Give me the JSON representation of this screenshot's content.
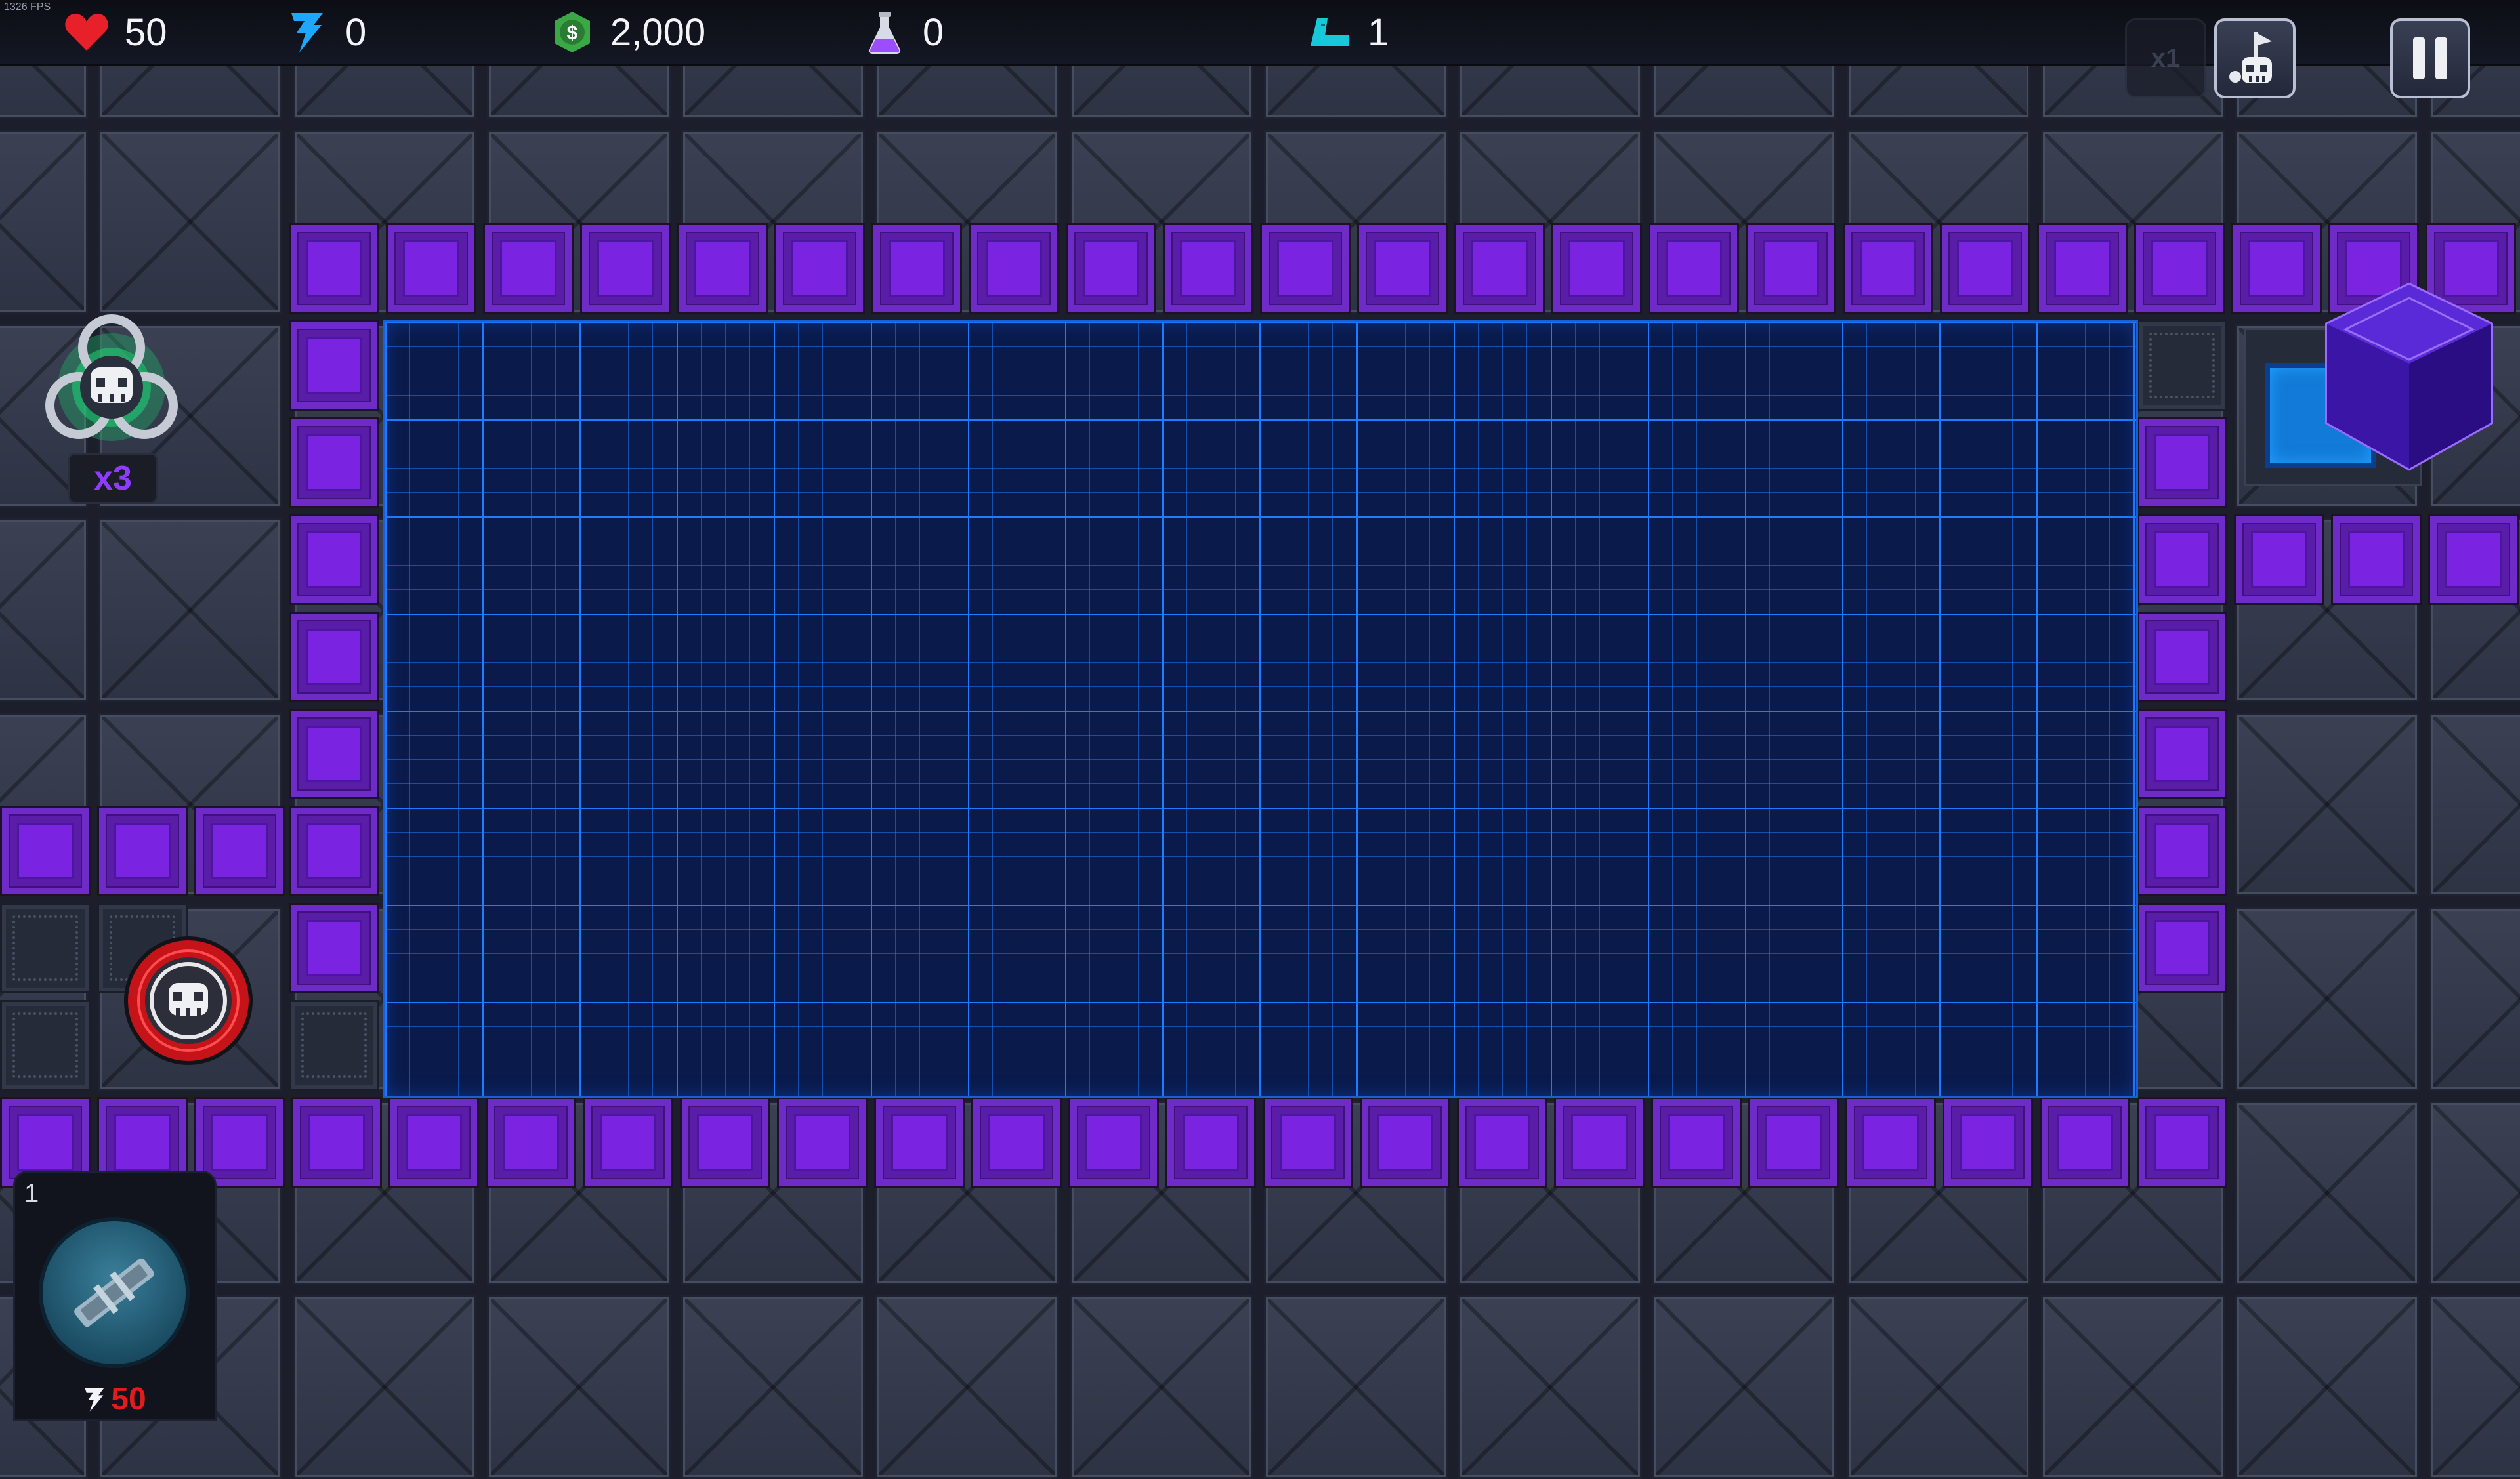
{
  "debug": {
    "fps": "1326 FPS"
  },
  "hud": {
    "lives": {
      "icon": "heart-icon",
      "value": "50",
      "color": "#e8202a"
    },
    "energy": {
      "icon": "lightning-icon",
      "value": "0",
      "color": "#1ea7ff"
    },
    "money": {
      "icon": "dollar-coin-icon",
      "value": "2,000",
      "color": "#3aa845"
    },
    "research": {
      "icon": "potion-flask-icon",
      "value": "0",
      "color": "#9b4dff"
    },
    "level": {
      "icon": "level-boot-icon",
      "value": "1",
      "color": "#18c8d8"
    }
  },
  "controls": {
    "speed_button": {
      "label": "x1",
      "enabled": false
    },
    "call_wave_button": {
      "icon": "skull-wave-icon"
    },
    "pause_button": {
      "icon": "pause-icon"
    }
  },
  "spawn": {
    "multiplier": "x3",
    "icon": "biohazard-skull-icon"
  },
  "tower_bar": {
    "slot_number": "1",
    "tower_icon": "tower-build-icon",
    "cost_icon": "lightning-icon",
    "cost": "50"
  },
  "colors": {
    "path": "#7a23e0",
    "grid": "#1f7cff",
    "core": "#6a2cff"
  }
}
